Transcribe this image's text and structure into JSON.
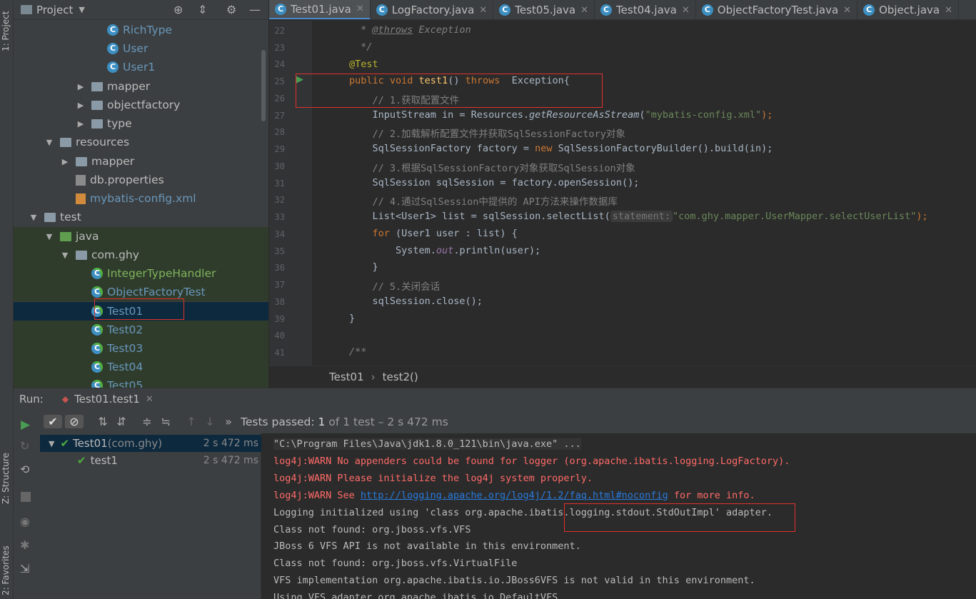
{
  "left_strip": {
    "project_label": "1: Project",
    "structure_label": "Z: Structure",
    "favorites_label": "2: Favorites"
  },
  "project_panel": {
    "title": "Project",
    "tree": [
      {
        "label": "RichType",
        "icon": "class-icon",
        "level": 6
      },
      {
        "label": "User",
        "icon": "class-icon",
        "level": 6
      },
      {
        "label": "User1",
        "icon": "class-icon",
        "level": 6
      },
      {
        "label": "mapper",
        "icon": "package-icon",
        "arrow": "▶",
        "level": 5
      },
      {
        "label": "objectfactory",
        "icon": "package-icon",
        "arrow": "▶",
        "level": 5
      },
      {
        "label": "type",
        "icon": "package-icon",
        "arrow": "▶",
        "level": 5
      },
      {
        "label": "resources",
        "icon": "folder-icon",
        "arrow": "▼",
        "level": 3
      },
      {
        "label": "mapper",
        "icon": "folder-icon",
        "arrow": "▶",
        "level": 4
      },
      {
        "label": "db.properties",
        "icon": "properties-icon",
        "level": 4
      },
      {
        "label": "mybatis-config.xml",
        "icon": "xml-icon",
        "level": 4
      },
      {
        "label": "test",
        "icon": "folder-icon",
        "arrow": "▼",
        "level": 2
      },
      {
        "label": "java",
        "icon": "test-folder-icon",
        "arrow": "▼",
        "level": 3
      },
      {
        "label": "com.ghy",
        "icon": "package-icon",
        "arrow": "▼",
        "level": 4
      },
      {
        "label": "IntegerTypeHandler",
        "icon": "test-class-icon",
        "level": 5
      },
      {
        "label": "ObjectFactoryTest",
        "icon": "test-class-icon",
        "level": 5
      },
      {
        "label": "Test01",
        "icon": "test-class-icon",
        "level": 5,
        "selected": true
      },
      {
        "label": "Test02",
        "icon": "test-class-icon",
        "level": 5
      },
      {
        "label": "Test03",
        "icon": "test-class-icon",
        "level": 5
      },
      {
        "label": "Test04",
        "icon": "test-class-icon",
        "level": 5
      },
      {
        "label": "Test05",
        "icon": "test-class-icon",
        "level": 5
      }
    ]
  },
  "editor": {
    "tabs": [
      {
        "label": "Test01.java",
        "active": true
      },
      {
        "label": "LogFactory.java"
      },
      {
        "label": "Test05.java"
      },
      {
        "label": "Test04.java"
      },
      {
        "label": "ObjectFactoryTest.java"
      },
      {
        "label": "Object.java"
      }
    ],
    "line_numbers": [
      "22",
      "23",
      "24",
      "25",
      "26",
      "27",
      "28",
      "29",
      "30",
      "31",
      "32",
      "33",
      "34",
      "35",
      "36",
      "37",
      "38",
      "39",
      "40",
      "41"
    ],
    "breadcrumb": {
      "class": "Test01",
      "sep": "›",
      "method": "test2()"
    }
  },
  "run_panel": {
    "label": "Run:",
    "tab": "Test01.test1",
    "status_prefix": "Tests passed: ",
    "status_count": "1",
    "status_suffix": " of 1 test – 2 s 472 ms",
    "tests": [
      {
        "name": "Test01",
        "pkg": " (com.ghy)",
        "time": "2 s 472 ms"
      },
      {
        "name": "test1",
        "pkg": "",
        "time": "2 s 472 ms"
      }
    ],
    "console": {
      "l1": "\"C:\\Program Files\\Java\\jdk1.8.0_121\\bin\\java.exe\" ...",
      "l2": "log4j:WARN No appenders could be found for logger (org.apache.ibatis.logging.LogFactory).",
      "l3": "log4j:WARN Please initialize the log4j system properly.",
      "l4a": "log4j:WARN See ",
      "l4b": "http://logging.apache.org/log4j/1.2/faq.html#noconfig",
      "l4c": " for more info.",
      "l5": "Logging initialized using 'class org.apache.ibatis.logging.stdout.StdOutImpl' adapter.",
      "l6": "Class not found: org.jboss.vfs.VFS",
      "l7": "JBoss 6 VFS API is not available in this environment.",
      "l8": "Class not found: org.jboss.vfs.VirtualFile",
      "l9": "VFS implementation org.apache.ibatis.io.JBoss6VFS is not valid in this environment.",
      "l10": "Using VFS adapter org.apache.ibatis.io.DefaultVFS"
    }
  },
  "code": {
    "c22a": " * ",
    "c22b": "@throws",
    "c22c": " Exception",
    "c23": " */",
    "c24": "@Test",
    "c25a": "public void ",
    "c25b": "test1",
    "c25c": "() ",
    "c25d": "throws",
    "c25e": "  Exception{",
    "c26": "    // 1.获取配置文件",
    "c27a": "    InputStream in = Resources.",
    "c27b": "getResourceAsStream",
    "c27c": "(",
    "c27d": "\"mybatis-config.xml\"",
    "c27e": ");",
    "c28": "    // 2.加载解析配置文件并获取SqlSessionFactory对象",
    "c29a": "    SqlSessionFactory factory = ",
    "c29b": "new",
    " c29c": "",
    "c29d": " SqlSessionFactoryBuilder().build(in);",
    "c30": "    // 3.根据SqlSessionFactory对象获取SqlSession对象",
    "c31": "    SqlSession sqlSession = factory.openSession();",
    "c32": "    // 4.通过SqlSession中提供的 API方法来操作数据库",
    "c33a": "    List<User1> list = sqlSession.selectList(",
    "c33b": "statement:",
    "c33c": "\"com.ghy.mapper.UserMapper.selectUserList\"",
    "c33d": ");",
    "c34a": "    ",
    "c34b": "for",
    " c34c": "",
    "c34d": " (User1 user : list) {",
    "c35a": "        System.",
    "c35b": "out",
    "c35c": ".println(user);",
    "c36": "    }",
    "c37": "    // 5.关闭会话",
    "c38": "    sqlSession.close();",
    "c39": "}",
    "c41": "/**"
  },
  "colors": {
    "accent": "#4a88c7",
    "pass": "#4fad3f",
    "warn": "#ff6b68",
    "highlight_box": "#e0312d"
  }
}
